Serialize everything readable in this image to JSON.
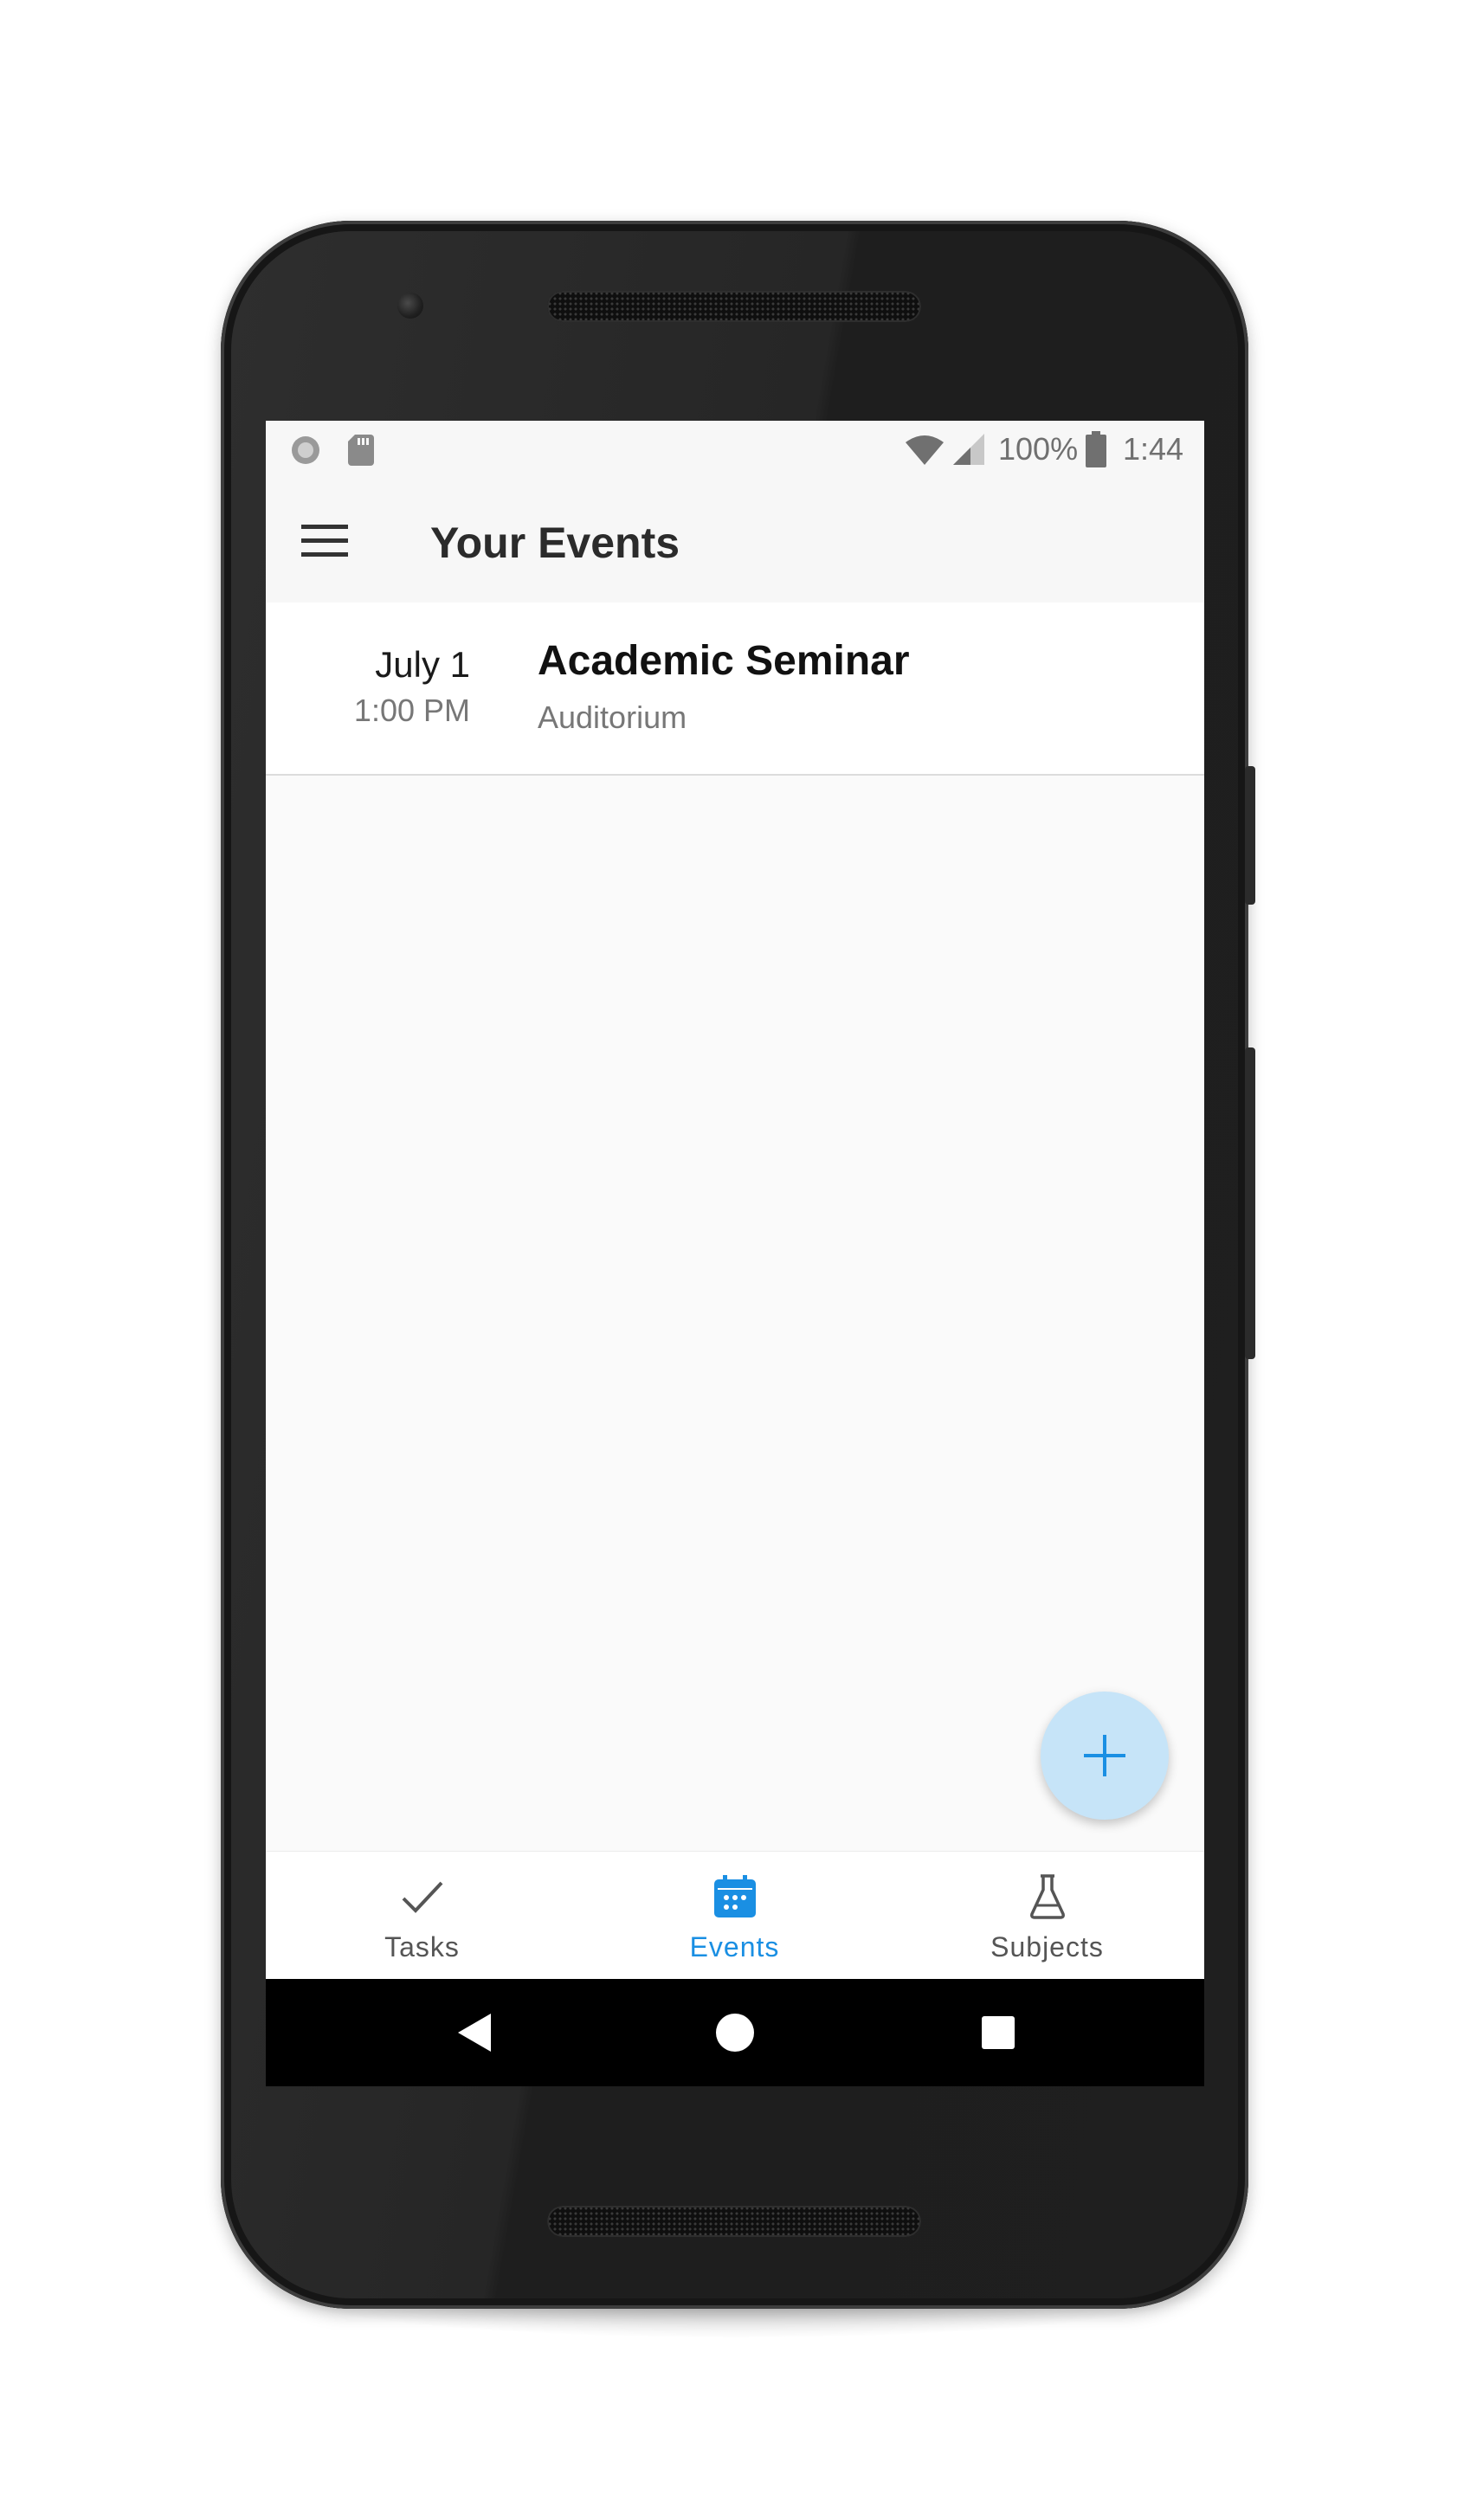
{
  "status_bar": {
    "battery_text": "100%",
    "time": "1:44",
    "icons": [
      "circle-status-icon",
      "sd-card-icon",
      "wifi-icon",
      "cell-signal-icon",
      "battery-icon"
    ]
  },
  "app_bar": {
    "title": "Your Events",
    "menu_icon": "hamburger-menu-icon"
  },
  "events": [
    {
      "date": "July 1",
      "time": "1:00 PM",
      "title": "Academic Seminar",
      "location": "Auditorium"
    }
  ],
  "fab": {
    "icon": "plus-icon",
    "color": "#c6e4f8",
    "icon_color": "#1a8fe3"
  },
  "bottom_nav": {
    "active_color": "#1a8fe3",
    "items": [
      {
        "label": "Tasks",
        "icon": "check-icon",
        "active": false
      },
      {
        "label": "Events",
        "icon": "calendar-icon",
        "active": true
      },
      {
        "label": "Subjects",
        "icon": "flask-icon",
        "active": false
      }
    ]
  },
  "system_nav": [
    "back-icon",
    "home-icon",
    "recents-icon"
  ]
}
